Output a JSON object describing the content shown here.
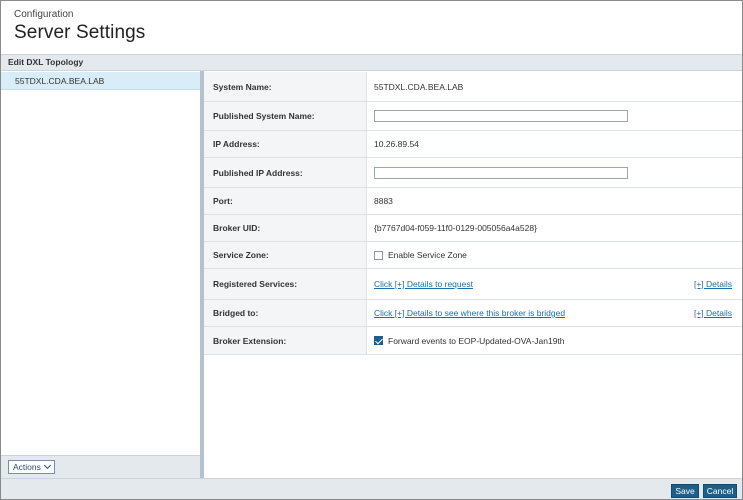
{
  "header": {
    "breadcrumb": "Configuration",
    "title": "Server Settings"
  },
  "section": {
    "title": "Edit DXL Topology"
  },
  "tree": {
    "items": [
      {
        "label": "55TDXL.CDA.BEA.LAB",
        "selected": true
      }
    ],
    "actions_label": "Actions"
  },
  "form": {
    "system_name": {
      "label": "System Name:",
      "value": "55TDXL.CDA.BEA.LAB"
    },
    "published_system_name": {
      "label": "Published System Name:",
      "value": ""
    },
    "ip_address": {
      "label": "IP Address:",
      "value": "10.26.89.54"
    },
    "published_ip_address": {
      "label": "Published IP Address:",
      "value": ""
    },
    "port": {
      "label": "Port:",
      "value": "8883"
    },
    "broker_uid": {
      "label": "Broker UID:",
      "value": "{b7767d04-f059-11f0-0129-005056a4a528}"
    },
    "service_zone": {
      "label": "Service Zone:",
      "checkbox_label": "Enable Service Zone",
      "checked": false
    },
    "registered_services": {
      "label": "Registered Services:",
      "link": "Click [+] Details to request",
      "details_link": "[+] Details"
    },
    "bridged_to": {
      "label": "Bridged to:",
      "link": "Click [+] Details to see where this broker is bridged",
      "details_link": "[+] Details"
    },
    "broker_extension": {
      "label": "Broker Extension:",
      "checkbox_label": "Forward events to EOP-Updated-OVA-Jan19th",
      "checked": true
    }
  },
  "footer": {
    "save_label": "Save",
    "cancel_label": "Cancel"
  },
  "colors": {
    "accent": "#1c5e8c",
    "link": "#1a6fa8",
    "selected_row": "#d9edf8",
    "bar": "#e4e9ee"
  }
}
